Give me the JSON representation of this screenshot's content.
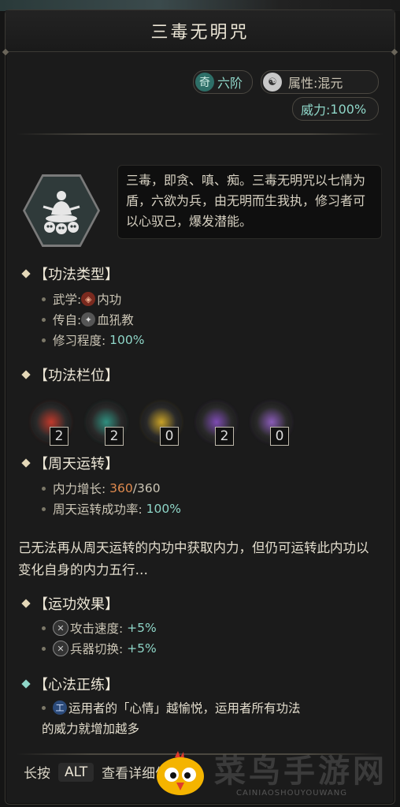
{
  "title": "三毒无明咒",
  "tier": {
    "badge": "奇",
    "level": "六阶"
  },
  "attribute": {
    "label": "属性:",
    "value": "混元"
  },
  "power": {
    "label": "威力:",
    "value": "100%"
  },
  "description": "三毒，即贪、嗔、痴。三毒无明咒以七情为盾，六欲为兵，由无明而生我执，修习者可以心驭己，爆发潜能。",
  "sections": {
    "type": {
      "header": "【功法类型】",
      "martial_label": "武学:",
      "martial_value": "内功",
      "source_label": "传自:",
      "source_value": "血犼教",
      "progress_label": "修习程度:",
      "progress_value": "100%"
    },
    "slots": {
      "header": "【功法栏位】",
      "items": [
        {
          "count": "2",
          "color": "#c0392b"
        },
        {
          "count": "2",
          "color": "#2f8f7f"
        },
        {
          "count": "0",
          "color": "#c9a227"
        },
        {
          "count": "2",
          "color": "#7d4bb3"
        },
        {
          "count": "0",
          "color": "#8a5bb8"
        }
      ]
    },
    "cycle": {
      "header": "【周天运转】",
      "gain_label": "内力增长:",
      "gain_current": "360",
      "gain_max": "/360",
      "rate_label": "周天运转成功率:",
      "rate_value": "100%",
      "note": "己无法再从周天运转的内功中获取内力，但仍可运转此内功以变化自身的内力五行…"
    },
    "effects": {
      "header": "【运功效果】",
      "speed_label": "攻击速度:",
      "speed_value": "+5%",
      "switch_label": "兵器切换:",
      "switch_value": "+5%"
    },
    "heart": {
      "header": "【心法正练】",
      "text_line1": "运用者的「心情」越愉悦，运用者所有功法",
      "text_line2": "的威力就增加越多"
    }
  },
  "footer": {
    "prefix": "长按",
    "key": "ALT",
    "suffix": "查看详细信息…"
  },
  "watermark": {
    "main": "菜鸟手游网",
    "sub": "CAINIAOSHOUYOUWANG"
  }
}
